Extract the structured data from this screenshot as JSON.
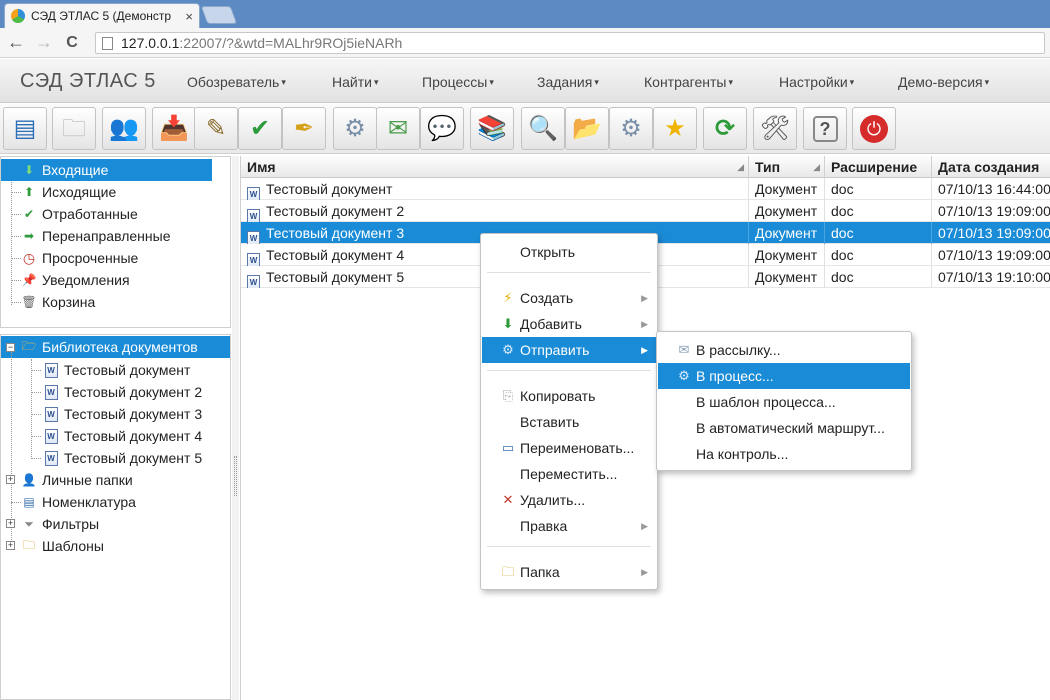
{
  "browser": {
    "tab_title": "СЭД ЭТЛАС 5 (Демонстр",
    "tab_close": "×",
    "back": "←",
    "forward": "→",
    "reload": "C",
    "url_host": "127.0.0.1",
    "url_path": ":22007/?&wtd=MALhr9ROj5ieNARh"
  },
  "app": {
    "brand": "СЭД ЭТЛАС 5",
    "menu": [
      {
        "label": "Обозреватель"
      },
      {
        "label": "Найти"
      },
      {
        "label": "Процессы"
      },
      {
        "label": "Задания"
      },
      {
        "label": "Контрагенты"
      },
      {
        "label": "Настройки"
      },
      {
        "label": "Демо-версия"
      }
    ],
    "caret": "▾"
  },
  "toolbar": {
    "buttons": [
      {
        "icon": "window-list-icon",
        "glyph": "▤"
      },
      {
        "icon": "folder-disabled-icon",
        "glyph": "🗀"
      },
      {
        "icon": "users-icon",
        "glyph": "👥"
      },
      {
        "icon": "inbox-arrow-icon",
        "glyph": "📥"
      },
      {
        "icon": "pencil-icon",
        "glyph": "✎"
      },
      {
        "icon": "double-check-icon",
        "glyph": "✔"
      },
      {
        "icon": "sign-pen-icon",
        "glyph": "✒"
      },
      {
        "icon": "gear-process-icon",
        "glyph": "⚙"
      },
      {
        "icon": "send-mail-icon",
        "glyph": "✉"
      },
      {
        "icon": "message-send-icon",
        "glyph": "💬"
      },
      {
        "icon": "books-search-icon",
        "glyph": "📚"
      },
      {
        "icon": "magnifier-icon",
        "glyph": "🔍"
      },
      {
        "icon": "folder-search-icon",
        "glyph": "📂"
      },
      {
        "icon": "gear-search-icon",
        "glyph": "⚙"
      },
      {
        "icon": "star-icon",
        "glyph": "★"
      },
      {
        "icon": "refresh-icon",
        "glyph": "⟳"
      },
      {
        "icon": "tools-icon",
        "glyph": "🛠"
      },
      {
        "icon": "help-icon",
        "glyph": "?"
      },
      {
        "icon": "power-icon",
        "glyph": "⏻"
      }
    ]
  },
  "folders": [
    {
      "label": "Входящие",
      "icon": "inbox-icon",
      "glyph": "⬇",
      "color": "#2e9b3a"
    },
    {
      "label": "Исходящие",
      "icon": "outbox-icon",
      "glyph": "⬆",
      "color": "#2e9b3a"
    },
    {
      "label": "Отработанные",
      "icon": "check-icon",
      "glyph": "✔",
      "color": "#2e9b3a"
    },
    {
      "label": "Перенаправленные",
      "icon": "forward-icon",
      "glyph": "➡",
      "color": "#2e9b3a"
    },
    {
      "label": "Просроченные",
      "icon": "clock-icon",
      "glyph": "◷",
      "color": "#c0392b"
    },
    {
      "label": "Уведомления",
      "icon": "pin-icon",
      "glyph": "📌",
      "color": "#2e9b3a"
    },
    {
      "label": "Корзина",
      "icon": "trash-icon",
      "glyph": "🗑",
      "color": "#666666"
    }
  ],
  "library": {
    "root": "Библиотека документов",
    "docs": [
      "Тестовый документ",
      "Тестовый документ 2",
      "Тестовый документ 3",
      "Тестовый документ 4",
      "Тестовый документ 5"
    ],
    "others": [
      {
        "label": "Личные папки",
        "icon": "personal-folder-icon",
        "glyph": "👤"
      },
      {
        "label": "Номенклатура",
        "icon": "nomenclature-icon",
        "glyph": "▤"
      },
      {
        "label": "Фильтры",
        "icon": "filter-icon",
        "glyph": "⏷"
      },
      {
        "label": "Шаблоны",
        "icon": "templates-folder-icon",
        "glyph": "🗀"
      }
    ],
    "expand": "−",
    "collapse": "+"
  },
  "grid": {
    "columns": [
      "Имя",
      "Тип",
      "Расширение",
      "Дата создания"
    ],
    "rows": [
      {
        "name": "Тестовый документ",
        "type": "Документ",
        "ext": "doc",
        "date": "07/10/13 16:44:00"
      },
      {
        "name": "Тестовый документ 2",
        "type": "Документ",
        "ext": "doc",
        "date": "07/10/13 19:09:00"
      },
      {
        "name": "Тестовый документ 3",
        "type": "Документ",
        "ext": "doc",
        "date": "07/10/13 19:09:00"
      },
      {
        "name": "Тестовый документ 4",
        "type": "Документ",
        "ext": "doc",
        "date": "07/10/13 19:09:00"
      },
      {
        "name": "Тестовый документ 5",
        "type": "Документ",
        "ext": "doc",
        "date": "07/10/13 19:10:00"
      }
    ],
    "doc_glyph": "W"
  },
  "context_menu": {
    "items": [
      {
        "label": "Открыть"
      },
      {
        "label": "Создать",
        "icon": "lightning-icon",
        "glyph": "⚡"
      },
      {
        "label": "Добавить",
        "icon": "add-arrow-icon",
        "glyph": "⬇"
      },
      {
        "label": "Отправить",
        "icon": "gear-send-icon",
        "glyph": "⚙"
      },
      {
        "label": "Копировать",
        "icon": "copy-icon",
        "glyph": "⎘"
      },
      {
        "label": "Вставить"
      },
      {
        "label": "Переименовать...",
        "icon": "rename-icon",
        "glyph": "▭"
      },
      {
        "label": "Переместить..."
      },
      {
        "label": "Удалить...",
        "icon": "delete-icon",
        "glyph": "✕"
      },
      {
        "label": "Правка"
      },
      {
        "label": "Папка",
        "icon": "folder-icon",
        "glyph": "🗀"
      }
    ],
    "arrow": "▶"
  },
  "submenu": {
    "items": [
      {
        "label": "В рассылку...",
        "icon": "mailing-icon",
        "glyph": "✉"
      },
      {
        "label": "В процесс...",
        "icon": "process-gear-icon",
        "glyph": "⚙"
      },
      {
        "label": "В шаблон процесса..."
      },
      {
        "label": "В автоматический маршрут..."
      },
      {
        "label": "На контроль..."
      }
    ]
  },
  "colors": {
    "accent": "#1a8bd6",
    "brand": "#555555"
  }
}
